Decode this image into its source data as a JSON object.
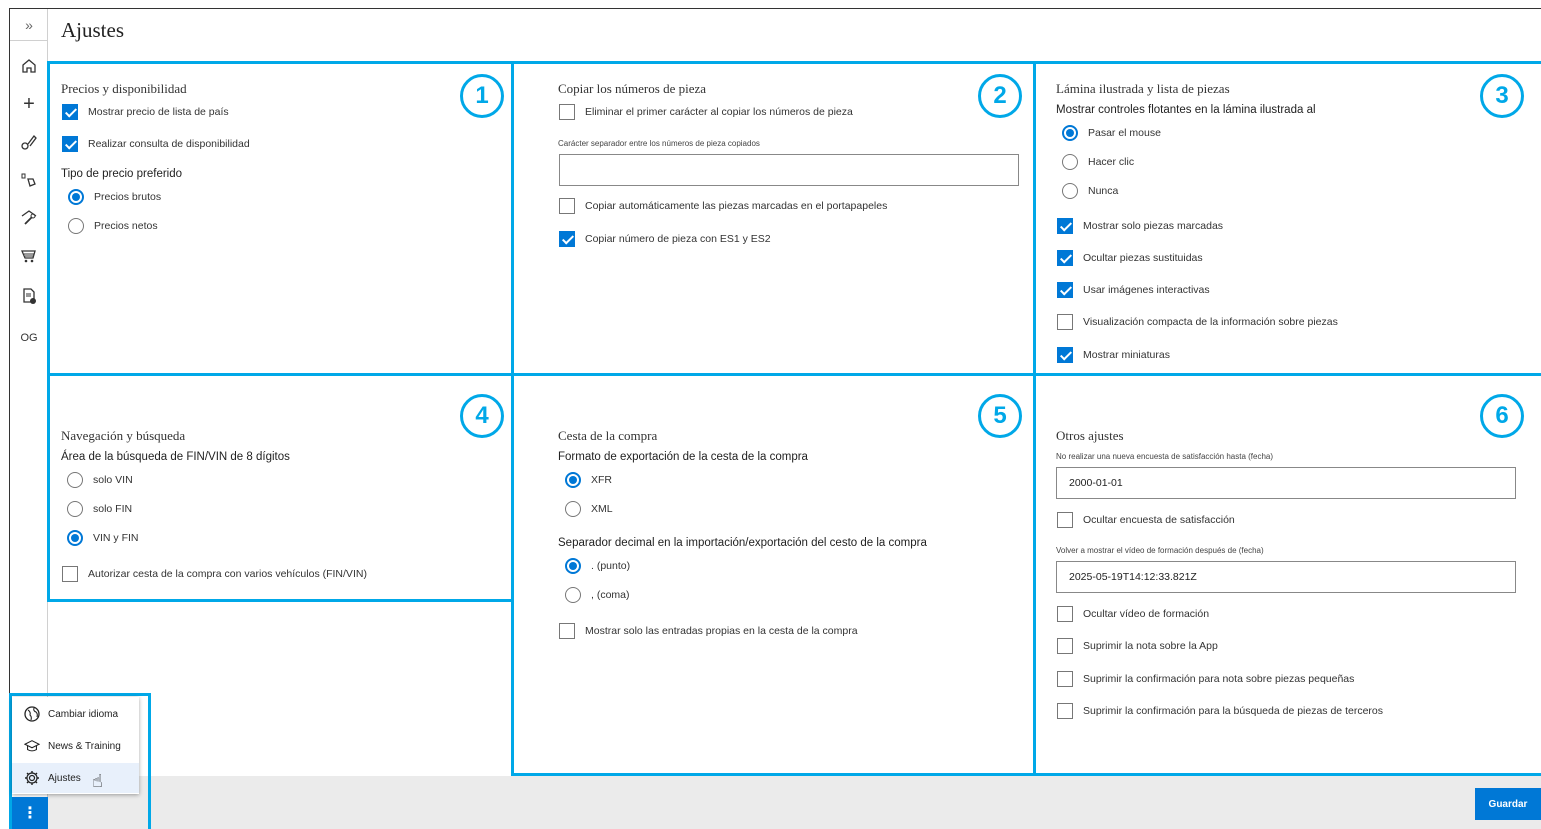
{
  "page": {
    "title": "Ajustes"
  },
  "sidebar": {
    "expand_icon": "double-chevron-right-icon",
    "items": [
      {
        "icon": "home-icon",
        "glyph": "⌂"
      },
      {
        "icon": "plus-icon",
        "glyph": "+"
      },
      {
        "icon": "parts-search-icon",
        "glyph": "⚲"
      },
      {
        "icon": "parts-catalog-icon",
        "glyph": "⚙"
      },
      {
        "icon": "service-icon",
        "glyph": "⚒"
      },
      {
        "icon": "cart-icon",
        "glyph": "🛒"
      },
      {
        "icon": "document-info-icon",
        "glyph": "🗎"
      }
    ],
    "user_initials": "OG"
  },
  "sections": {
    "s1": {
      "badge": "1",
      "title": "Precios y disponibilidad",
      "show_country_price": "Mostrar precio de lista de país",
      "availability_check": "Realizar consulta de disponibilidad",
      "price_type_label": "Tipo de precio preferido",
      "gross_prices": "Precios brutos",
      "net_prices": "Precios netos"
    },
    "s2": {
      "badge": "2",
      "title": "Copiar los números de pieza",
      "remove_first_char": "Eliminar el primer carácter al copiar los números de pieza",
      "separator_label": "Carácter separador entre los números de pieza copiados",
      "separator_value": "",
      "auto_copy": "Copiar automáticamente las piezas marcadas en el portapapeles",
      "copy_es": "Copiar número de pieza con ES1 y ES2"
    },
    "s3": {
      "badge": "3",
      "title": "Lámina ilustrada y lista de piezas",
      "floating_label": "Mostrar controles flotantes en la lámina ilustrada al",
      "hover": "Pasar el mouse",
      "click": "Hacer clic",
      "never": "Nunca",
      "only_marked": "Mostrar solo piezas marcadas",
      "hide_replaced": "Ocultar piezas sustituidas",
      "interactive_images": "Usar imágenes interactivas",
      "compact_view": "Visualización compacta de la información sobre piezas",
      "thumbnails": "Mostrar miniaturas"
    },
    "s4": {
      "badge": "4",
      "title": "Navegación y búsqueda",
      "area_label": "Área de la búsqueda de FIN/VIN de 8 dígitos",
      "only_vin": "solo VIN",
      "only_fin": "solo FIN",
      "vin_fin": "VIN y FIN",
      "multi_vehicle": "Autorizar cesta de la compra con varios vehículos (FIN/VIN)"
    },
    "s5": {
      "badge": "5",
      "title": "Cesta de la compra",
      "export_label": "Formato de exportación de la cesta de la compra",
      "xfr": "XFR",
      "xml": "XML",
      "decimal_label": "Separador decimal en la importación/exportación del cesto de la compra",
      "dot": ". (punto)",
      "comma": ", (coma)",
      "own_entries": "Mostrar solo las entradas propias en la cesta de la compra"
    },
    "s6": {
      "badge": "6",
      "title": "Otros ajustes",
      "survey_date_label": "No realizar una nueva encuesta de satisfacción hasta (fecha)",
      "survey_date_value": "2000-01-01",
      "hide_survey": "Ocultar encuesta de satisfacción",
      "video_date_label": "Volver a mostrar el vídeo de formación después de (fecha)",
      "video_date_value": "2025-05-19T14:12:33.821Z",
      "hide_video": "Ocultar vídeo de formación",
      "suppress_app_note": "Suprimir la nota sobre la App",
      "suppress_small_parts": "Suprimir la confirmación para nota sobre piezas pequeñas",
      "suppress_third_party": "Suprimir la confirmación para la búsqueda de piezas de terceros"
    }
  },
  "menu": {
    "change_language": "Cambiar idioma",
    "news_training": "News & Training",
    "settings": "Ajustes"
  },
  "footer": {
    "save_label": "Guardar"
  },
  "colors": {
    "accent": "#0078d6",
    "highlight": "#00a8e8"
  }
}
